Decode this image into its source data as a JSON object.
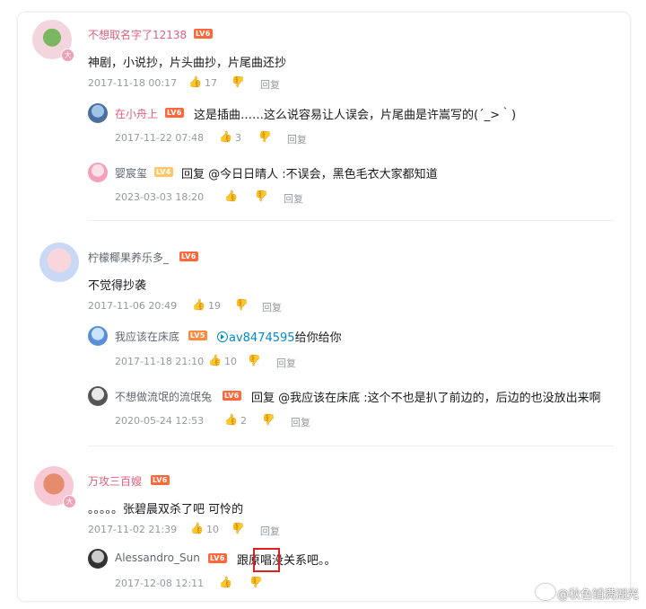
{
  "comments": [
    {
      "username": "不想取名字了12138",
      "level": "LV6",
      "badge": "大",
      "text": "神剧，小说抄，片头曲抄，片尾曲还抄",
      "time": "2017-11-18 00:17",
      "likes": "17",
      "reply_label": "回复",
      "replies": [
        {
          "username": "在小舟上",
          "level": "LV6",
          "text": "这是插曲……这么说容易让人误会，片尾曲是许嵩写的(´_>｀)",
          "time": "2017-11-22 07:48",
          "likes": "3",
          "reply_label": "回复"
        },
        {
          "username": "婴宸玺",
          "level": "LV4",
          "reply_prefix": "回复 @今日日晴人 :",
          "text": "不误会，黑色毛衣大家都知道",
          "time": "2023-03-03 18:20",
          "reply_label": "回复"
        }
      ]
    },
    {
      "username": "柠檬椰果养乐多_",
      "level": "LV6",
      "text": "不觉得抄袭",
      "time": "2017-11-06 20:49",
      "likes": "19",
      "reply_label": "回复",
      "replies": [
        {
          "username": "我应该在床底",
          "level": "LV5",
          "link_text": "av8474595",
          "text": "给你给你",
          "time": "2017-11-18 21:10",
          "likes": "10",
          "reply_label": "回复"
        },
        {
          "username": "不想做流氓的流氓兔",
          "level": "LV6",
          "reply_prefix": "回复 @我应该在床底 :",
          "text": "这个不也是扒了前边的，后边的也没放出来啊",
          "time": "2020-05-24 12:53",
          "likes": "2",
          "reply_label": "回复"
        }
      ]
    },
    {
      "username": "万攻三百嫂",
      "level": "LV6",
      "badge": "大",
      "text": "。。。。。张碧晨双杀了吧 可怜的",
      "time": "2017-11-02 21:39",
      "likes": "10",
      "reply_label": "回复",
      "replies": [
        {
          "username": "Alessandro_Sun",
          "level": "LV6",
          "text": "跟原唱没关系吧。。",
          "time": "2017-12-08 12:11"
        }
      ]
    }
  ],
  "watermark": "@秋色铺满湖光",
  "colors": {
    "vip_name": "#e0607e",
    "name": "#61666d",
    "link": "#008ac5",
    "lv6": "#ff6a3d",
    "lv5": "#ff8a3d",
    "lv4": "#ffc766",
    "highlight_box": "#e02020"
  }
}
